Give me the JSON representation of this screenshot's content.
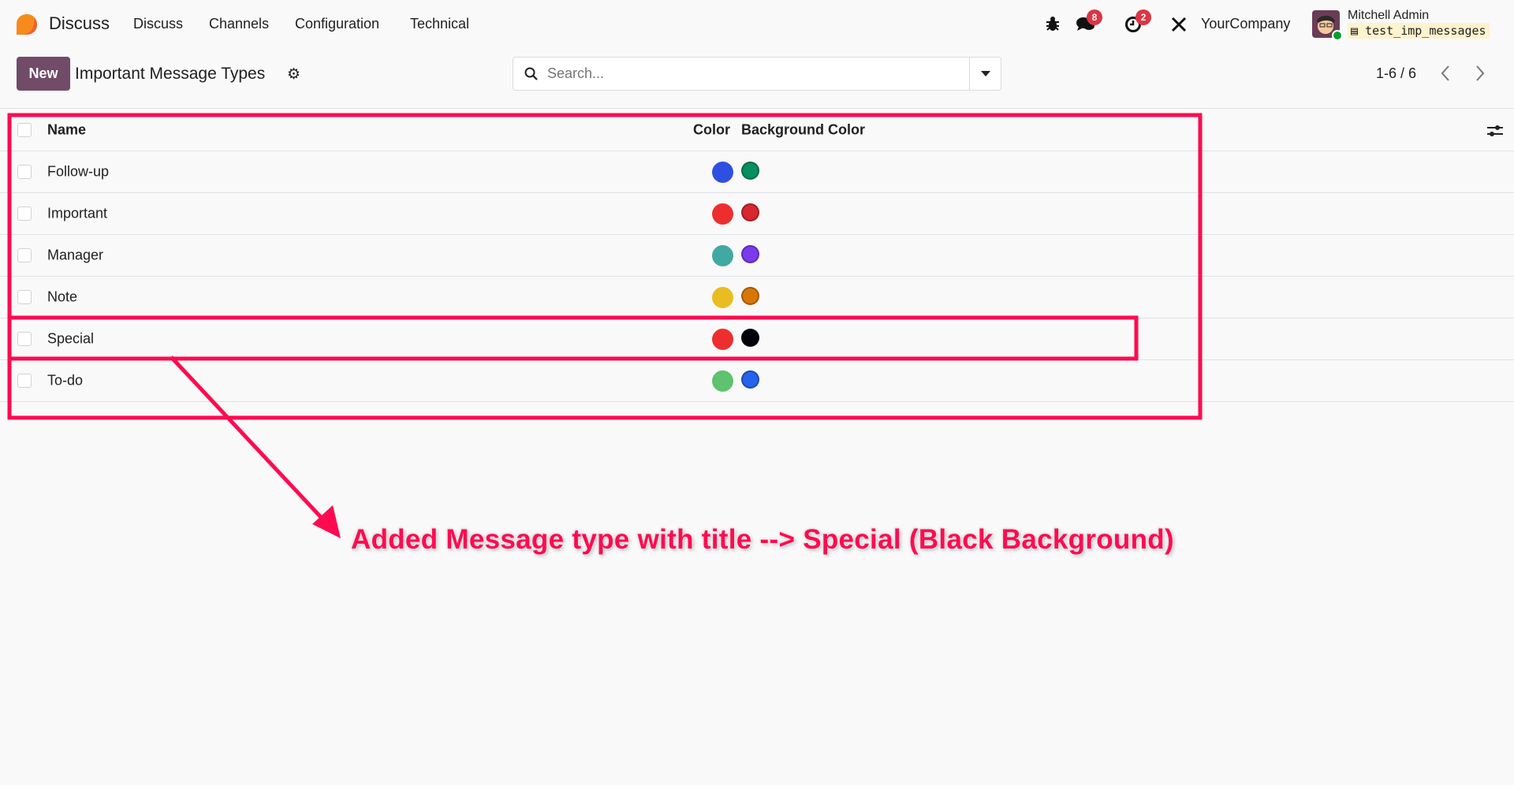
{
  "app": {
    "brand": "Discuss",
    "nav": [
      "Discuss",
      "Channels",
      "Configuration",
      "Technical"
    ]
  },
  "systray": {
    "messages_badge": "8",
    "activities_badge": "2",
    "company": "YourCompany",
    "user": "Mitchell Admin",
    "database": "test_imp_messages"
  },
  "control": {
    "new_label": "New",
    "title": "Important Message Types",
    "search_placeholder": "Search...",
    "pager": "1-6 / 6"
  },
  "table": {
    "headers": {
      "name": "Name",
      "color": "Color",
      "background": "Background Color"
    },
    "rows": [
      {
        "name": "Follow-up",
        "color": "#2f4fe0",
        "background": "#068f5f"
      },
      {
        "name": "Important",
        "color": "#ee2e2e",
        "background": "#d9262f"
      },
      {
        "name": "Manager",
        "color": "#40a9a3",
        "background": "#7c3aed"
      },
      {
        "name": "Note",
        "color": "#e9bd22",
        "background": "#d97706"
      },
      {
        "name": "Special",
        "color": "#ee2e2e",
        "background": "#02020a"
      },
      {
        "name": "To-do",
        "color": "#5ec26e",
        "background": "#2563eb"
      }
    ]
  },
  "annotation": {
    "text": "Added Message type with title --> Special (Black Background)",
    "color": "#ff0a50"
  }
}
